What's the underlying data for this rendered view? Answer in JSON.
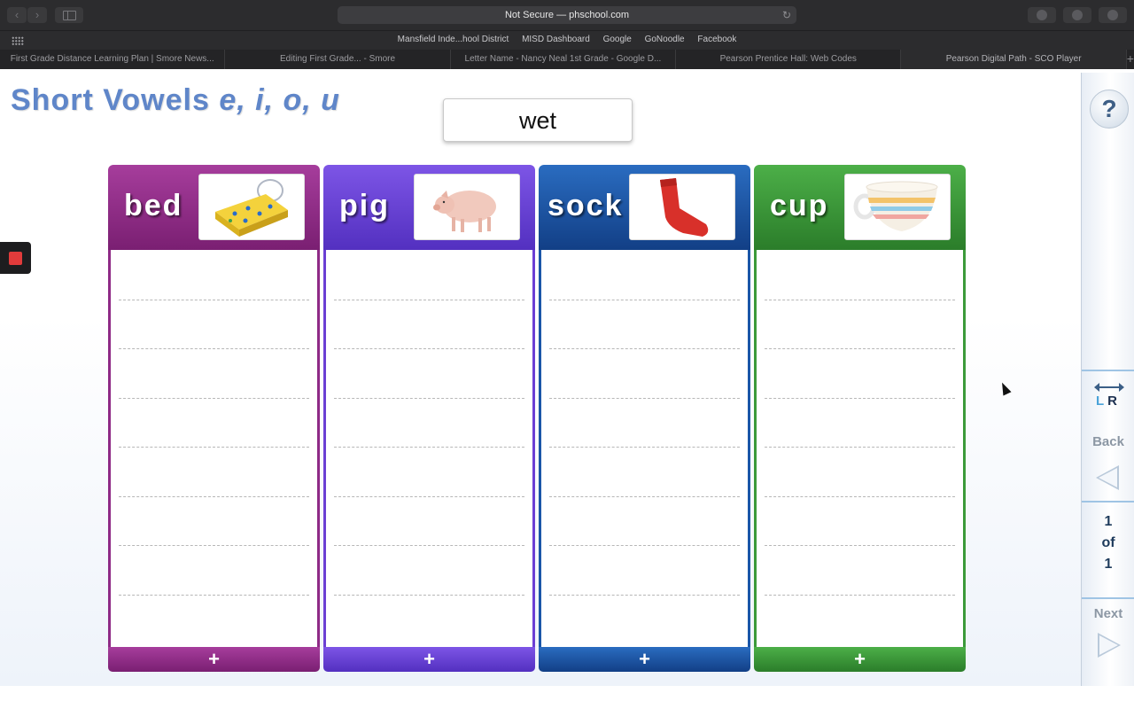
{
  "browser": {
    "address": "Not Secure — phschool.com",
    "favorites": [
      "Mansfield Inde...hool District",
      "MISD Dashboard",
      "Google",
      "GoNoodle",
      "Facebook"
    ],
    "tabs": [
      "First Grade Distance Learning Plan | Smore News...",
      "Editing First Grade... - Smore",
      "Letter Name - Nancy Neal 1st Grade - Google D...",
      "Pearson Prentice Hall: Web Codes",
      "Pearson Digital Path - SCO Player"
    ],
    "new_tab_icon": "+"
  },
  "activity": {
    "title_main": "Short Vowels",
    "title_vowels": "e, i, o, u",
    "current_word": "wet",
    "columns": [
      {
        "word": "bed",
        "color": "#8e2a86",
        "picture": "bed"
      },
      {
        "word": "pig",
        "color": "#6b3fd4",
        "picture": "pig"
      },
      {
        "word": "sock",
        "color": "#1a56a8",
        "picture": "sock"
      },
      {
        "word": "cup",
        "color": "#3c9a3a",
        "picture": "cup"
      }
    ],
    "add_icon": "+"
  },
  "nav": {
    "help": "?",
    "lr_left": "L",
    "lr_right": "R",
    "back": "Back",
    "next": "Next",
    "page_current": "1",
    "page_of": "of",
    "page_total": "1"
  }
}
